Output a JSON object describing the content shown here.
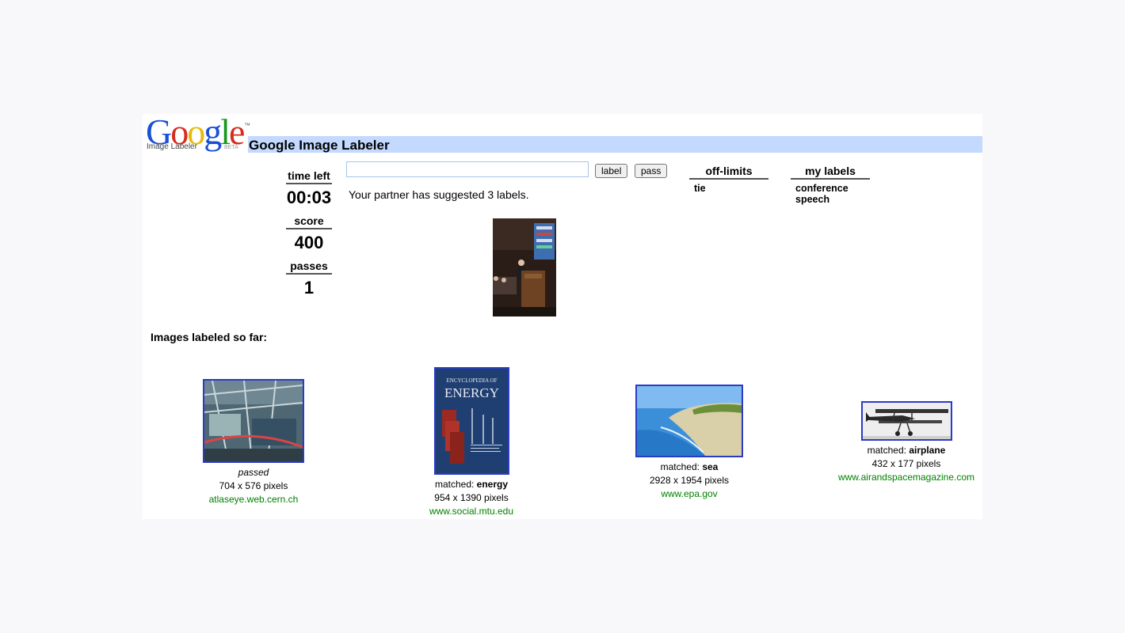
{
  "app": {
    "logo_text": "Google",
    "logo_subtitle": "Image Labeler",
    "logo_beta": "BETA",
    "title": "Google Image Labeler"
  },
  "stats": {
    "time_left_label": "time left",
    "time_left_value": "00:03",
    "score_label": "score",
    "score_value": "400",
    "passes_label": "passes",
    "passes_value": "1"
  },
  "controls": {
    "input_value": "",
    "label_button": "label",
    "pass_button": "pass",
    "partner_message": "Your partner has suggested 3 labels."
  },
  "off_limits": {
    "heading": "off-limits",
    "items": [
      "tie"
    ]
  },
  "my_labels": {
    "heading": "my labels",
    "items": [
      "conference",
      "speech"
    ]
  },
  "labeled": {
    "heading": "Images labeled so far:",
    "items": [
      {
        "status": "passed",
        "prefix": "",
        "word": "",
        "size": "704 x 576 pixels",
        "source": "atlaseye.web.cern.ch"
      },
      {
        "status": "",
        "prefix": "matched: ",
        "word": "energy",
        "size": "954 x 1390 pixels",
        "source": "www.social.mtu.edu",
        "cover_line1": "ENCYCLOPEDIA OF",
        "cover_line2": "ENERGY"
      },
      {
        "status": "",
        "prefix": "matched: ",
        "word": "sea",
        "size": "2928 x 1954 pixels",
        "source": "www.epa.gov"
      },
      {
        "status": "",
        "prefix": "matched: ",
        "word": "airplane",
        "size": "432 x 177 pixels",
        "source": "www.airandspacemagazine.com"
      }
    ]
  },
  "colors": {
    "title_bar": "#c3d9ff",
    "thumb_border": "#2b3bc4",
    "source_link": "#008000"
  }
}
